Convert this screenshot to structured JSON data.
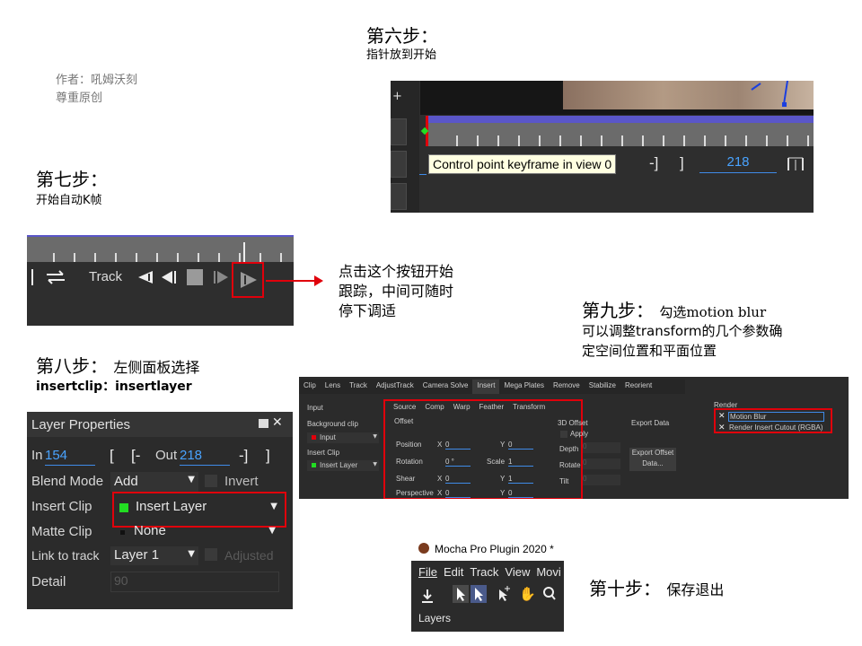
{
  "author": {
    "line1": "作者：吼姆沃刻",
    "line2": "尊重原创"
  },
  "step6": {
    "title": "第六步：",
    "desc": "指针放到开始",
    "tooltip": "Control point keyframe in view 0",
    "frame_value": "218",
    "plus": "+",
    "bracket_out": "-]",
    "bracket_close": "]"
  },
  "step7": {
    "title": "第七步：",
    "desc": "开始自动K帧",
    "track_label": "Track",
    "annotation_lines": [
      "点击这个按钮开始",
      "跟踪，中间可随时",
      "停下调适"
    ]
  },
  "step8": {
    "title": "第八步：",
    "subtitle": "左侧面板选择",
    "desc": "insertclip：insertlayer",
    "panel_title": "Layer Properties",
    "in_label": "In",
    "in_value": "154",
    "out_label": "Out",
    "out_value": "218",
    "bracket_open": "[",
    "bracket_open_dash": "[-",
    "bracket_close_dash": "-]",
    "bracket_close": "]",
    "blend_mode_label": "Blend Mode",
    "blend_mode_value": "Add",
    "invert_label": "Invert",
    "insert_clip_label": "Insert Clip",
    "insert_clip_value": "Insert Layer",
    "matte_clip_label": "Matte Clip",
    "matte_clip_value": "None",
    "link_track_label": "Link to track",
    "link_track_value": "Layer 1",
    "adjusted_label": "Adjusted",
    "detail_label": "Detail",
    "detail_value": "90"
  },
  "step9": {
    "title": "第九步：",
    "subtitle": "勾选motion blur",
    "desc_line1": "可以调整transform的几个参数确",
    "desc_line2": "定空间位置和平面位置",
    "tabs": [
      "Clip",
      "Lens",
      "Track",
      "AdjustTrack",
      "Camera Solve",
      "Insert",
      "Mega Plates",
      "Remove",
      "Stabilize",
      "Reorient"
    ],
    "subtabs": [
      "Source",
      "Comp",
      "Warp",
      "Feather",
      "Transform"
    ],
    "input_header": "Input",
    "background_clip_label": "Background clip",
    "background_clip_value": "Input",
    "insert_clip_label": "Insert Clip",
    "insert_clip_value": "Insert Layer",
    "offset_header": "Offset",
    "position_label": "Position",
    "rotation_label": "Rotation",
    "shear_label": "Shear",
    "perspective_label": "Perspective",
    "x_label": "X",
    "y_label": "Y",
    "scale_label": "Scale",
    "position_x": "0",
    "position_y": "0",
    "rotation_value": "0 °",
    "scale_value": "1",
    "shear_x": "0",
    "shear_y": "1",
    "perspective_x": "0",
    "perspective_y": "0",
    "offset3d_header": "3D Offset",
    "apply_label": "Apply",
    "depth_label": "Depth",
    "depth_value": "0",
    "rotate_label": "Rotate",
    "rotate_value": "0",
    "tilt_label": "Tilt",
    "tilt_value": "0",
    "export_header": "Export Data",
    "export_button": "Export Offset Data...",
    "render_header": "Render",
    "motion_blur_label": "Motion Blur",
    "render_cutout_label": "Render Insert Cutout (RGBA)"
  },
  "step10": {
    "title": "第十步：",
    "subtitle": "保存退出",
    "window_title": "Mocha Pro Plugin 2020 *",
    "menu": [
      "File",
      "Edit",
      "Track",
      "View",
      "Movi"
    ],
    "layers_label": "Layers"
  },
  "colors": {
    "highlight_red": "#e0000b",
    "field_blue": "#49a3ff",
    "panel_dark": "#2b2b2b",
    "insert_green": "#22dd22",
    "timeline_purple": "#5a56c8"
  }
}
